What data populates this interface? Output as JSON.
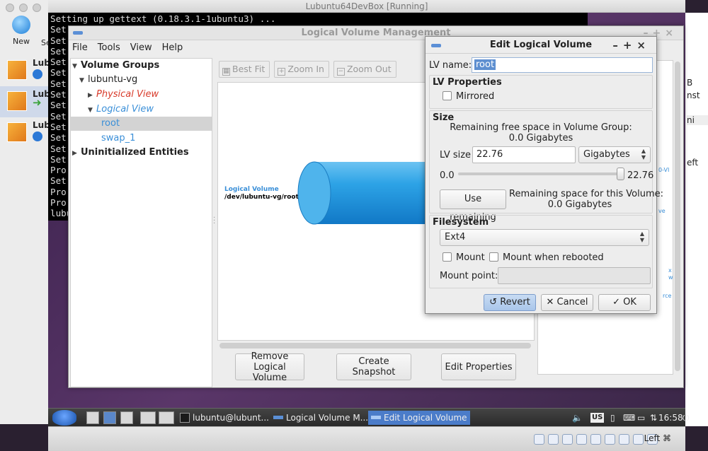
{
  "vb_manager": {
    "new_label": "New",
    "settings_fragment": "Se",
    "vms": [
      {
        "name": "Lubu",
        "state_fragment": "P"
      },
      {
        "name": "Lubu",
        "state_fragment": "R"
      },
      {
        "name": "Lubu",
        "state_fragment": "P"
      }
    ]
  },
  "vm_window": {
    "title": "Lubuntu64DevBox [Running]"
  },
  "terminal": {
    "lines": [
      "Setting up gettext (0.18.3.1-1ubuntu3) ...",
      "Set",
      "Set",
      "Set",
      "Set",
      "Set",
      "Set",
      "Set",
      "Set",
      "Set",
      "Set",
      "Set",
      "Set",
      "Set",
      "Pro",
      "Set",
      "Pro",
      "Pro",
      "lubu"
    ]
  },
  "host_right": {
    "fragments": [
      "B",
      "nst",
      "ni",
      "eft"
    ]
  },
  "lvm": {
    "title": "Logical Volume Management",
    "menu": [
      "File",
      "Tools",
      "View",
      "Help"
    ],
    "tree": {
      "volume_groups": "Volume Groups",
      "vg": "lubuntu-vg",
      "physical_view": "Physical View",
      "logical_view": "Logical View",
      "lv_root": "root",
      "lv_swap": "swap_1",
      "uninitialized": "Uninitialized Entities"
    },
    "toolbar": {
      "best_fit": "Best Fit",
      "zoom_in": "Zoom In",
      "zoom_out": "Zoom Out"
    },
    "canvas": {
      "lv_label": "Logical Volume",
      "lv_path": "/dev/lubuntu-vg/root"
    },
    "actions": {
      "remove": "Remove\nLogical Volume",
      "snapshot": "Create Snapshot",
      "edit": "Edit Properties"
    },
    "props_fragments": [
      "0-VI",
      "ve",
      "x",
      "w",
      "rce"
    ]
  },
  "dialog": {
    "title": "Edit Logical Volume",
    "lv_name_label": "LV name:",
    "lv_name_value": "root",
    "lv_properties": {
      "heading": "LV Properties",
      "mirrored": "Mirrored"
    },
    "size": {
      "heading": "Size",
      "remaining_vg_1": "Remaining free space in Volume Group:",
      "remaining_vg_2": "0.0 Gigabytes",
      "lv_size_label": "LV size",
      "lv_size_value": "22.76",
      "unit": "Gigabytes",
      "slider_min": "0.0",
      "slider_max": "22.76",
      "slider_fraction": 1.0,
      "use_remaining": "Use remaining",
      "remaining_lv_1": "Remaining space for this Volume:",
      "remaining_lv_2": "0.0 Gigabytes"
    },
    "filesystem": {
      "heading": "Filesystem",
      "type": "Ext4",
      "mount": "Mount",
      "mount_rebooted": "Mount when rebooted",
      "mount_point_label": "Mount point:",
      "mount_point_value": ""
    },
    "buttons": {
      "revert": "Revert",
      "cancel": "Cancel",
      "ok": "OK"
    }
  },
  "taskbar": {
    "items": [
      "lubuntu@lubunt...",
      "Logical Volume M...",
      "Edit Logical Volume"
    ],
    "keyboard": "US",
    "clock": "16:58"
  },
  "vb_status": {
    "host_key": "Left ⌘"
  },
  "colors": {
    "accent_blue": "#3a8fd8",
    "physical_view_red": "#d83a2a",
    "selection": "#5e8fd0",
    "taskbar_active": "#4b7cc9"
  }
}
